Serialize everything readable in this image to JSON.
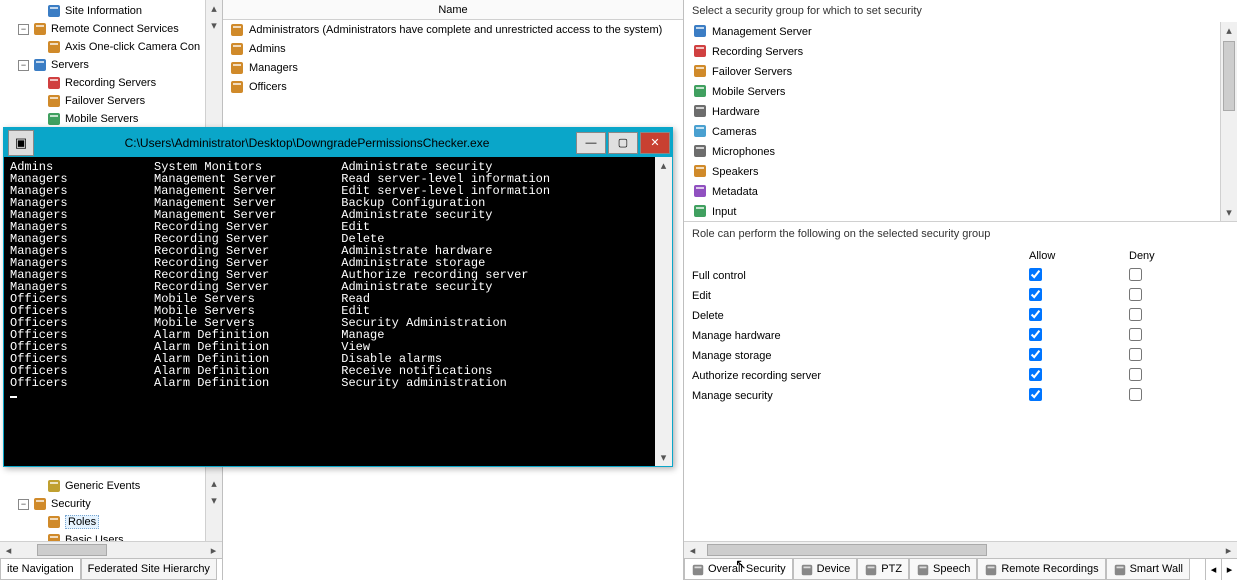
{
  "left": {
    "tree": [
      {
        "indent": 1,
        "exp": "none",
        "icon": "info-icon",
        "label": "Site Information"
      },
      {
        "indent": 0,
        "exp": "-",
        "icon": "connect-icon",
        "label": "Remote Connect Services"
      },
      {
        "indent": 1,
        "exp": "none",
        "icon": "axis-icon",
        "label": "Axis One-click Camera Con"
      },
      {
        "indent": 0,
        "exp": "-",
        "icon": "server-icon",
        "label": "Servers"
      },
      {
        "indent": 1,
        "exp": "none",
        "icon": "rec-server-icon",
        "label": "Recording Servers"
      },
      {
        "indent": 1,
        "exp": "none",
        "icon": "failover-icon",
        "label": "Failover Servers"
      },
      {
        "indent": 1,
        "exp": "none",
        "icon": "mobile-icon",
        "label": "Mobile Servers"
      }
    ],
    "tree_lower": [
      {
        "indent": 1,
        "exp": "none",
        "icon": "generic-icon",
        "label": "Generic Events"
      },
      {
        "indent": 0,
        "exp": "-",
        "icon": "security-icon",
        "label": "Security"
      },
      {
        "indent": 1,
        "exp": "none",
        "icon": "roles-icon",
        "label": "Roles",
        "selected": true
      },
      {
        "indent": 1,
        "exp": "none",
        "icon": "users-icon",
        "label": "Basic Users"
      }
    ],
    "bottom_tabs": [
      "ite Navigation",
      "Federated Site Hierarchy"
    ]
  },
  "middle": {
    "header": "Name",
    "rows": [
      "Administrators (Administrators have complete and unrestricted access to the system)",
      "Admins",
      "Managers",
      "Officers"
    ]
  },
  "right": {
    "instruction": "Select a security group for which to set security",
    "groups": [
      "Management Server",
      "Recording Servers",
      "Failover Servers",
      "Mobile Servers",
      "Hardware",
      "Cameras",
      "Microphones",
      "Speakers",
      "Metadata",
      "Input"
    ],
    "perm_instruction": "Role can perform the following on the selected security group",
    "cols": [
      "Allow",
      "Deny"
    ],
    "perms": [
      {
        "label": "Full control",
        "allow": true,
        "deny": false
      },
      {
        "label": "Edit",
        "allow": true,
        "deny": false
      },
      {
        "label": "Delete",
        "allow": true,
        "deny": false
      },
      {
        "label": "Manage hardware",
        "allow": true,
        "deny": false
      },
      {
        "label": "Manage storage",
        "allow": true,
        "deny": false
      },
      {
        "label": "Authorize recording server",
        "allow": true,
        "deny": false
      },
      {
        "label": "Manage security",
        "allow": true,
        "deny": false
      }
    ],
    "tabs": [
      "Overall Security",
      "Device",
      "PTZ",
      "Speech",
      "Remote Recordings",
      "Smart Wall"
    ]
  },
  "console": {
    "title": "C:\\Users\\Administrator\\Desktop\\DowngradePermissionsChecker.exe",
    "lines": [
      [
        "Admins",
        "System Monitors",
        "Administrate security"
      ],
      [
        "Managers",
        "Management Server",
        "Read server-level information"
      ],
      [
        "Managers",
        "Management Server",
        "Edit server-level information"
      ],
      [
        "Managers",
        "Management Server",
        "Backup Configuration"
      ],
      [
        "Managers",
        "Management Server",
        "Administrate security"
      ],
      [
        "Managers",
        "Recording Server",
        "Edit"
      ],
      [
        "Managers",
        "Recording Server",
        "Delete"
      ],
      [
        "Managers",
        "Recording Server",
        "Administrate hardware"
      ],
      [
        "Managers",
        "Recording Server",
        "Administrate storage"
      ],
      [
        "Managers",
        "Recording Server",
        "Authorize recording server"
      ],
      [
        "Managers",
        "Recording Server",
        "Administrate security"
      ],
      [
        "Officers",
        "Mobile Servers",
        "Read"
      ],
      [
        "Officers",
        "Mobile Servers",
        "Edit"
      ],
      [
        "Officers",
        "Mobile Servers",
        "Security Administration"
      ],
      [
        "Officers",
        "Alarm Definition",
        "Manage"
      ],
      [
        "Officers",
        "Alarm Definition",
        "View"
      ],
      [
        "Officers",
        "Alarm Definition",
        "Disable alarms"
      ],
      [
        "Officers",
        "Alarm Definition",
        "Receive notifications"
      ],
      [
        "Officers",
        "Alarm Definition",
        "Security administration"
      ]
    ]
  }
}
